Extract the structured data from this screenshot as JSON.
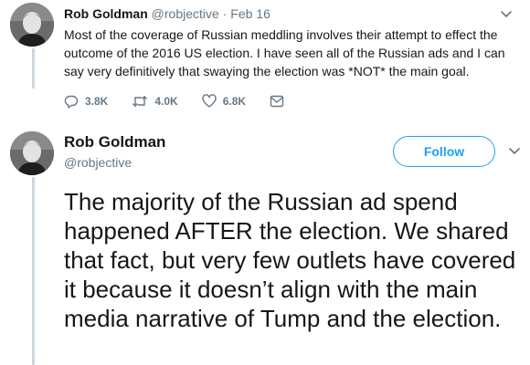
{
  "tweet1": {
    "author_name": "Rob Goldman",
    "handle": "@robjective",
    "separator": "·",
    "timestamp": "Feb 16",
    "text": "Most of the coverage of Russian meddling involves their attempt to effect the outcome of the 2016 US election.  I have seen all of the Russian ads and I can say very definitively that swaying the election was *NOT* the main goal.",
    "replies": "3.8K",
    "retweets": "4.0K",
    "likes": "6.8K"
  },
  "tweet2": {
    "author_name": "Rob Goldman",
    "handle": "@robjective",
    "follow_label": "Follow",
    "text": "The majority of the Russian ad spend happened AFTER the election.  We shared that fact, but very few outlets have covered it because it doesn’t align with the main media narrative of Tump and the election."
  },
  "colors": {
    "accent": "#1da1f2",
    "secondary_text": "#657786",
    "primary_text": "#14171a",
    "thread_line": "#ccd6dd"
  },
  "icons": {
    "reply": "reply-icon",
    "retweet": "retweet-icon",
    "like": "heart-icon",
    "dm": "envelope-icon",
    "more": "chevron-down-icon"
  }
}
